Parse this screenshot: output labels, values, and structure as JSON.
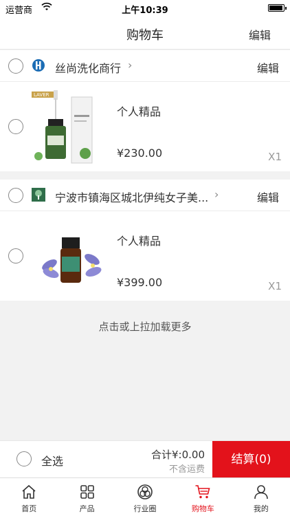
{
  "status_bar": {
    "carrier": "运营商",
    "time": "上午10:39"
  },
  "nav": {
    "title": "购物车",
    "edit": "编辑"
  },
  "shops": [
    {
      "name": "丝尚洗化商行",
      "edit": "编辑",
      "product": {
        "name": "个人精品",
        "price": "¥230.00",
        "qty": "X1",
        "image": "serum-dropper-bottle"
      }
    },
    {
      "name": "宁波市镇海区城北伊纯女子美...",
      "edit": "编辑",
      "product": {
        "name": "个人精品",
        "price": "¥399.00",
        "qty": "X1",
        "image": "essential-oil-bottle"
      }
    }
  ],
  "load_more": "点击或上拉加载更多",
  "checkout": {
    "select_all": "全选",
    "total": "合计¥:0.00",
    "shipping": "不含运费",
    "button": "结算(0)"
  },
  "tabs": [
    {
      "label": "首页",
      "icon": "home-icon"
    },
    {
      "label": "产品",
      "icon": "grid-icon"
    },
    {
      "label": "行业圈",
      "icon": "circles-icon"
    },
    {
      "label": "购物车",
      "icon": "cart-icon",
      "active": true
    },
    {
      "label": "我的",
      "icon": "user-icon"
    }
  ],
  "colors": {
    "accent": "#e3121b",
    "background": "#f2f2f2"
  }
}
